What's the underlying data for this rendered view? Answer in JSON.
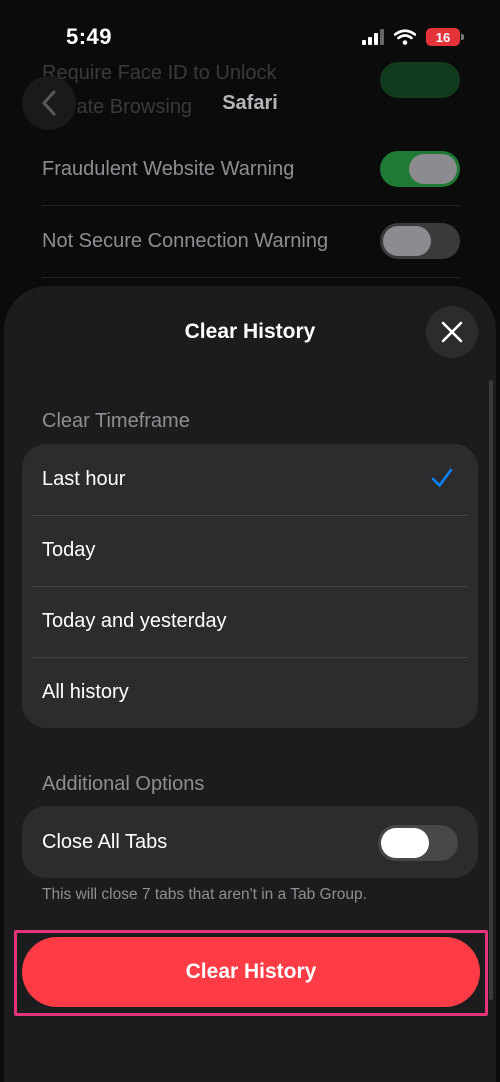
{
  "status_bar": {
    "time": "5:49",
    "battery_level": "16",
    "battery_color": "#e5333a"
  },
  "background": {
    "header_ghost_text": "Require Face ID to Unlock Private Browsing",
    "title": "Safari",
    "rows": [
      {
        "label": "Fraudulent Website Warning",
        "toggle_on": true
      },
      {
        "label": "Not Secure Connection Warning",
        "toggle_on": false
      }
    ]
  },
  "sheet": {
    "title": "Clear History",
    "timeframe_label": "Clear Timeframe",
    "timeframe_options": [
      {
        "label": "Last hour",
        "selected": true
      },
      {
        "label": "Today",
        "selected": false
      },
      {
        "label": "Today and yesterday",
        "selected": false
      },
      {
        "label": "All history",
        "selected": false
      }
    ],
    "additional_label": "Additional Options",
    "close_all_tabs_label": "Close All Tabs",
    "close_all_tabs_on": false,
    "footnote": "This will close 7 tabs that aren't in a Tab Group.",
    "clear_button_label": "Clear History",
    "accent_color": "#ff3b45",
    "check_color": "#0a84ff",
    "highlight_color": "#e6337a"
  }
}
